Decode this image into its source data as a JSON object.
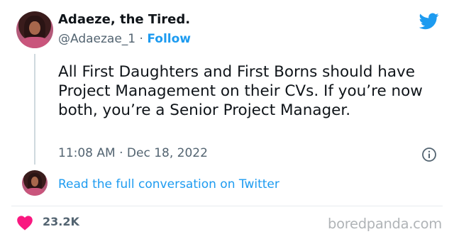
{
  "author": {
    "name": "Adaeze, the Tired.",
    "handle": "@Adaezae_1",
    "separator": "·",
    "follow_label": "Follow"
  },
  "tweet": {
    "text": "All First Daughters and First Borns should have Project Management on their CVs. If you’re now both, you’re a Senior Project Manager.",
    "timestamp": "11:08 AM · Dec 18, 2022"
  },
  "conversation_link": "Read the full conversation on Twitter",
  "engagement": {
    "likes": "23.2K"
  },
  "watermark": "boredpanda.com",
  "icons": {
    "brand": "twitter-bird-icon",
    "info": "info-icon",
    "like": "heart-icon"
  },
  "colors": {
    "accent": "#1d9bf0",
    "heart": "#f91880",
    "muted": "#536471",
    "text": "#0f1419"
  }
}
